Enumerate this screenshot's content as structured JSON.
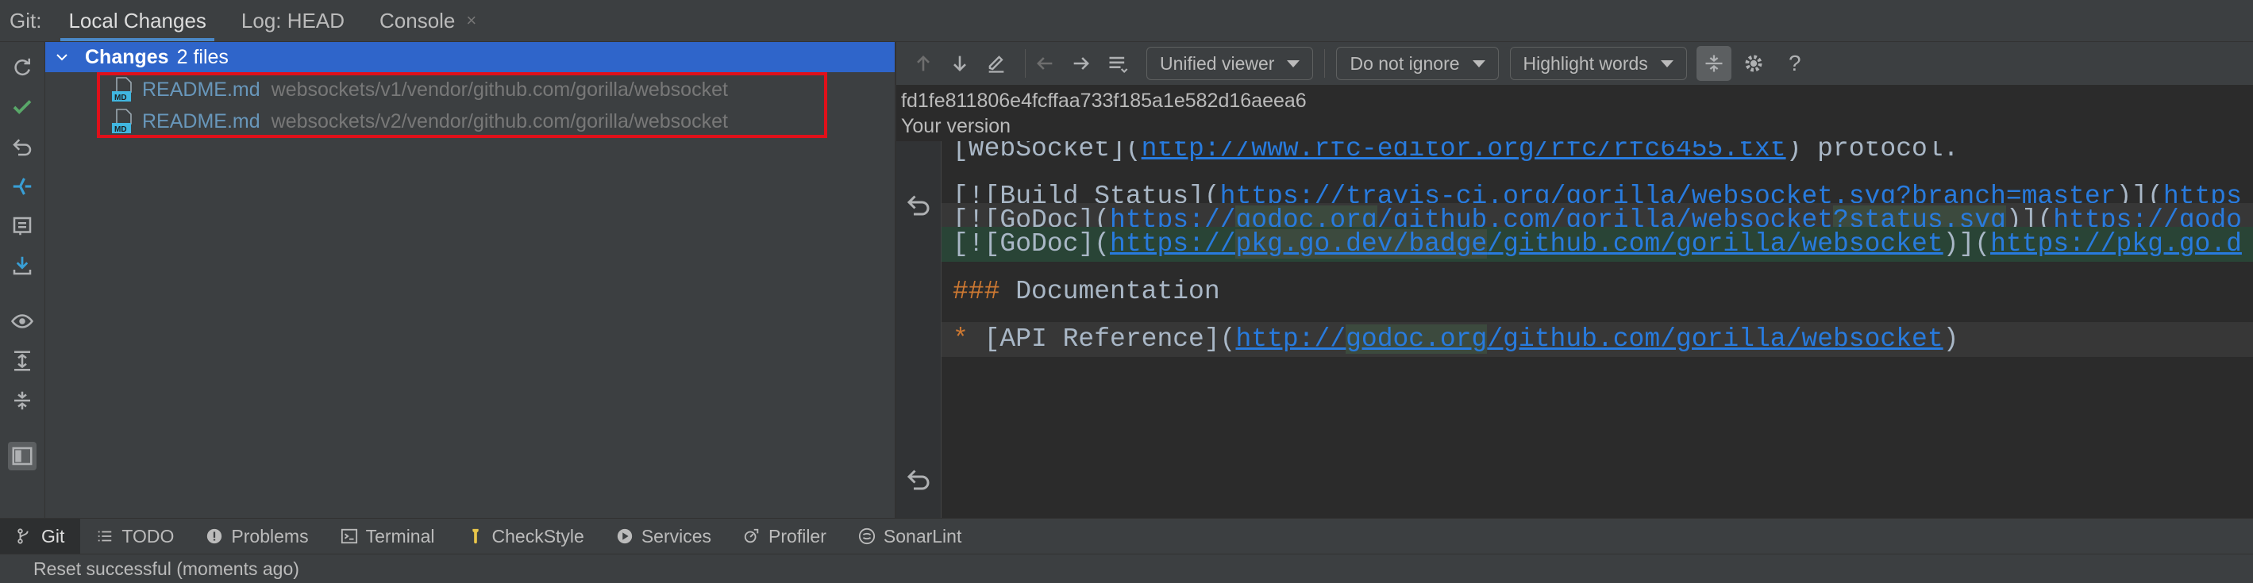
{
  "topbar": {
    "git_label": "Git:",
    "tabs": [
      {
        "label": "Local Changes",
        "active": true
      },
      {
        "label": "Log: HEAD",
        "active": false
      },
      {
        "label": "Console",
        "active": false,
        "closable": true
      }
    ],
    "close_glyph": "×"
  },
  "left_toolbar": {
    "icons": [
      "refresh-icon",
      "commit-checkmark-icon",
      "rollback-icon",
      "update-icon",
      "shelve-icon",
      "unshelve-icon",
      "preview-eye-icon",
      "expand-all-icon",
      "collapse-all-icon",
      "layout-toggle-icon"
    ]
  },
  "changes": {
    "title": "Changes",
    "count": "2 files",
    "files": [
      {
        "name": "README.md",
        "path": "websockets/v1/vendor/github.com/gorilla/websocket"
      },
      {
        "name": "README.md",
        "path": "websockets/v2/vendor/github.com/gorilla/websocket"
      }
    ],
    "highlight_color": "#e0101a"
  },
  "diff": {
    "toolbar": {
      "viewer": "Unified viewer",
      "whitespace": "Do not ignore",
      "highlight": "Highlight words",
      "help": "?"
    },
    "hash": "fd1fe811806e4fcffaa733f185a1e582d16aeea6",
    "version_label": "Your version",
    "lines": {
      "l1_pre": "[WebSocket](",
      "l1_url": "http://www.rfc-editor.org/rfc/rfc6455.txt",
      "l1_post": ") protocol.",
      "l3_pre": "[![Build Status](",
      "l3_url": "https://travis-ci.org/gorilla/websocket.svg?branch=master",
      "l3_post": ")](",
      "l3_url2": "https",
      "l4_pre": "[![GoDoc](",
      "l4_url_a": "https://",
      "l4_url_b": "godoc.org",
      "l4_url_c": "/github.com/gorilla/websocket",
      "l4_url_d": "?status.svg",
      "l4_post": ")](",
      "l4_url2": "https://godo",
      "l5_pre": "[![GoDoc](",
      "l5_url_a": "https://",
      "l5_url_b": "pkg.go.dev/badge",
      "l5_url_c": "/github.com/gorilla/websocket",
      "l5_post": ")](",
      "l5_url2": "https://pkg.go.d",
      "l7_hash": "###",
      "l7_text": " Documentation",
      "l9_star": "*",
      "l9_pre": " [API Reference](",
      "l9_url_a": "http://",
      "l9_url_b": "godoc.org",
      "l9_url_c": "/github.com/gorilla/websocket",
      "l9_post": ")"
    },
    "colors": {
      "added_bg": "#294436",
      "url": "#287bde",
      "heading": "#cc7832"
    }
  },
  "bottom_tools": [
    {
      "label": "Git",
      "icon": "git-branch-icon",
      "active": true
    },
    {
      "label": "TODO",
      "icon": "todo-list-icon"
    },
    {
      "label": "Problems",
      "icon": "problems-icon"
    },
    {
      "label": "Terminal",
      "icon": "terminal-icon"
    },
    {
      "label": "CheckStyle",
      "icon": "checkstyle-icon"
    },
    {
      "label": "Services",
      "icon": "services-play-icon"
    },
    {
      "label": "Profiler",
      "icon": "profiler-icon"
    },
    {
      "label": "SonarLint",
      "icon": "sonarlint-icon"
    }
  ],
  "status": {
    "text": "Reset successful (moments ago)"
  }
}
